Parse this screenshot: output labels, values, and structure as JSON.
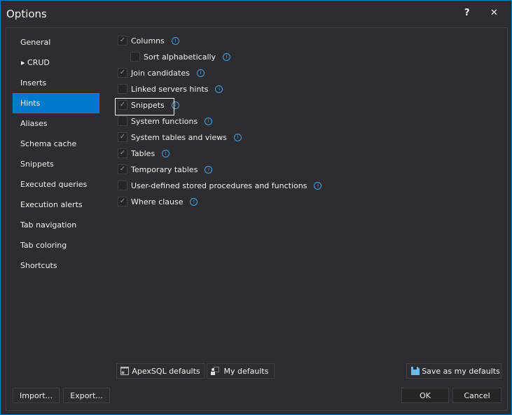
{
  "window": {
    "title": "Options",
    "help": "?",
    "close": "✕"
  },
  "sidebar": {
    "items": [
      {
        "label": "General"
      },
      {
        "label": "CRUD",
        "expandable": true
      },
      {
        "label": "Inserts"
      },
      {
        "label": "Hints",
        "selected": true
      },
      {
        "label": "Aliases"
      },
      {
        "label": "Schema cache"
      },
      {
        "label": "Snippets"
      },
      {
        "label": "Executed queries"
      },
      {
        "label": "Execution alerts"
      },
      {
        "label": "Tab navigation"
      },
      {
        "label": "Tab coloring"
      },
      {
        "label": "Shortcuts"
      }
    ]
  },
  "hints": [
    {
      "label": "Columns",
      "checked": true,
      "indent": false
    },
    {
      "label": "Sort alphabetically",
      "checked": false,
      "indent": true
    },
    {
      "label": "Join candidates",
      "checked": true,
      "indent": false
    },
    {
      "label": "Linked servers hints",
      "checked": false,
      "indent": false
    },
    {
      "label": "Snippets",
      "checked": true,
      "indent": false
    },
    {
      "label": "System functions",
      "checked": false,
      "indent": false
    },
    {
      "label": "System tables and views",
      "checked": true,
      "indent": false
    },
    {
      "label": "Tables",
      "checked": true,
      "indent": false
    },
    {
      "label": "Temporary tables",
      "checked": true,
      "indent": false
    },
    {
      "label": "User-defined stored procedures and functions",
      "checked": false,
      "indent": false
    },
    {
      "label": "Where clause",
      "checked": true,
      "indent": false
    }
  ],
  "buttons": {
    "apexsql_defaults": "ApexSQL defaults",
    "my_defaults": "My defaults",
    "save_defaults": "Save as my defaults",
    "import": "Import...",
    "export": "Export...",
    "ok": "OK",
    "cancel": "Cancel"
  }
}
